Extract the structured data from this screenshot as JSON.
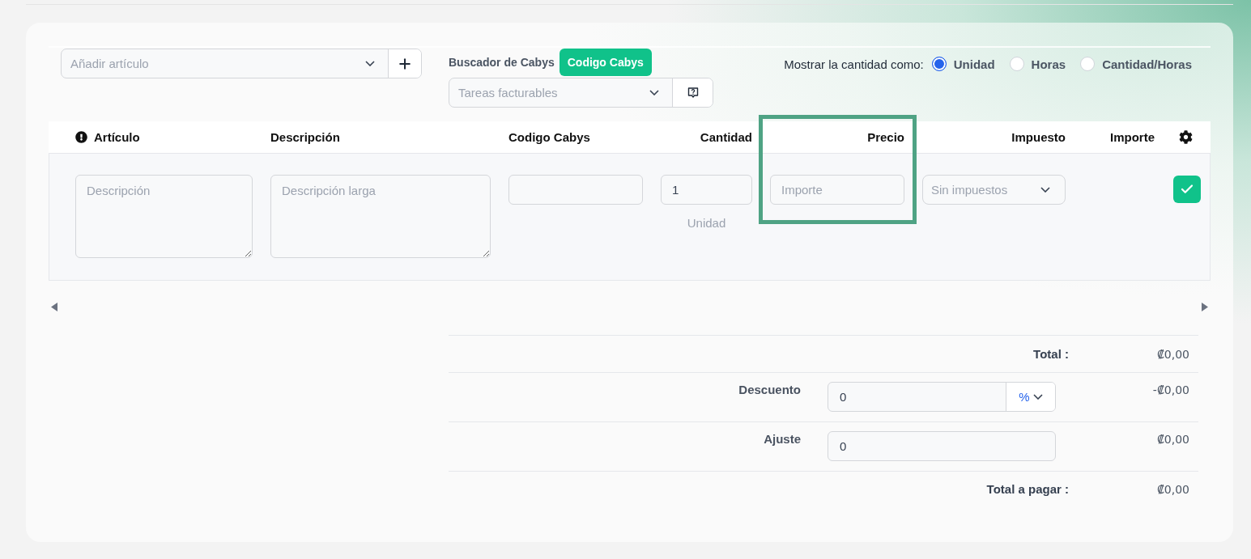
{
  "article_picker": {
    "placeholder": "Añadir artículo"
  },
  "cabys": {
    "label": "Buscador de Cabys",
    "button": "Codigo Cabys",
    "tasks_placeholder": "Tareas facturables"
  },
  "quantity_display": {
    "label": "Mostrar la cantidad como:",
    "options": [
      {
        "label": "Unidad",
        "selected": true
      },
      {
        "label": "Horas",
        "selected": false
      },
      {
        "label": "Cantidad/Horas",
        "selected": false
      }
    ]
  },
  "table": {
    "article_required": true,
    "columns": [
      {
        "label": "Artículo",
        "highlighted": false
      },
      {
        "label": "Descripción",
        "highlighted": false
      },
      {
        "label": "Codigo Cabys",
        "highlighted": false
      },
      {
        "label": "Cantidad",
        "highlighted": false
      },
      {
        "label": "Precio",
        "highlighted": true
      },
      {
        "label": "Impuesto",
        "highlighted": false
      },
      {
        "label": "Importe",
        "highlighted": false
      }
    ],
    "row": {
      "article_placeholder": "Descripción",
      "description_placeholder": "Descripción larga",
      "quantity": "1",
      "quantity_unit": "Unidad",
      "price_placeholder": "Importe",
      "tax": "Sin impuestos"
    }
  },
  "totals": {
    "total_label": "Total :",
    "total": "₡0,00",
    "discount": {
      "label": "Descuento",
      "value": "0",
      "type": "%",
      "amount": "-₡0,00"
    },
    "adjustment": {
      "label": "Ajuste",
      "value": "0",
      "amount": "₡0,00"
    },
    "due_label": "Total a pagar :",
    "due": "₡0,00"
  }
}
